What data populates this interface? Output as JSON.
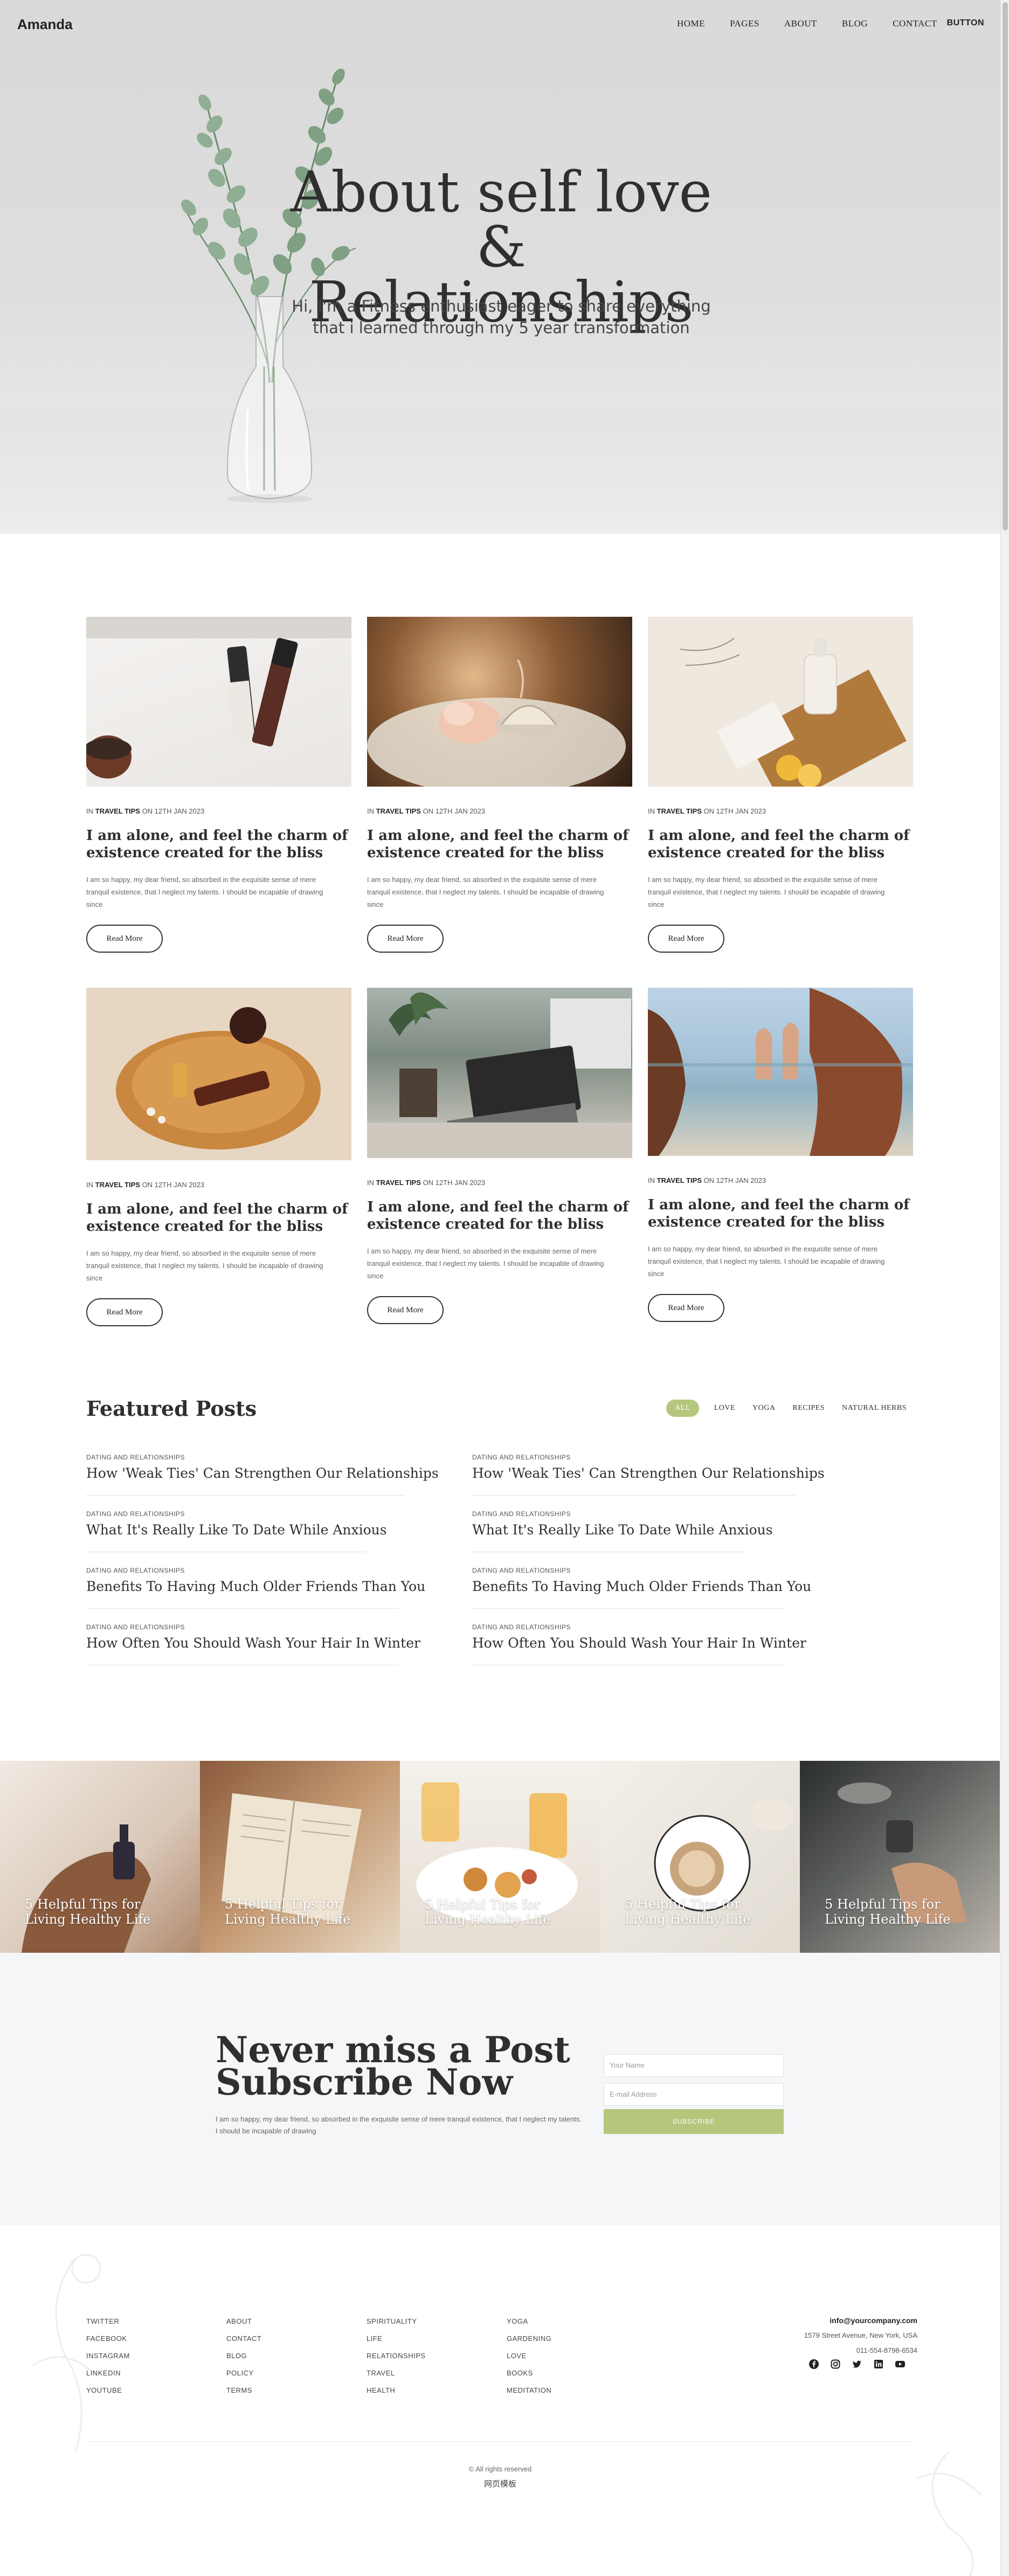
{
  "header": {
    "logo": "Amanda",
    "nav": [
      "HOME",
      "PAGES",
      "ABOUT",
      "BLOG",
      "CONTACT"
    ],
    "button": "BUTTON"
  },
  "hero": {
    "title_line1": "About self love &",
    "title_line2": "Relationships",
    "subtitle_line1": "Hi, I'm a Fitness enthusiast eager to share everything",
    "subtitle_line2": "that i learned through my 5 year transformation"
  },
  "posts": [
    {
      "in": "IN",
      "category": "TRAVEL TIPS",
      "date": "ON 12TH JAN 2023",
      "title": "I am alone, and feel the charm of existence created for the bliss",
      "excerpt": "I am so happy, my dear friend, so absorbed in the exquisite sense of mere tranquil existence, that I neglect my talents. I should be incapable of drawing since",
      "button": "Read More"
    },
    {
      "in": "IN",
      "category": "TRAVEL TIPS",
      "date": "ON 12TH JAN 2023",
      "title": "I am alone, and feel the charm of existence created for the bliss",
      "excerpt": "I am so happy, my dear friend, so absorbed in the exquisite sense of mere tranquil existence, that I neglect my talents. I should be incapable of drawing since",
      "button": "Read More"
    },
    {
      "in": "IN",
      "category": "TRAVEL TIPS",
      "date": "ON 12TH JAN 2023",
      "title": "I am alone, and feel the charm of existence created for the bliss",
      "excerpt": "I am so happy, my dear friend, so absorbed in the exquisite sense of mere tranquil existence, that I neglect my talents. I should be incapable of drawing since",
      "button": "Read More"
    },
    {
      "in": "IN",
      "category": "TRAVEL TIPS",
      "date": "ON 12TH JAN 2023",
      "title": "I am alone, and feel the charm of existence created for the bliss",
      "excerpt": "I am so happy, my dear friend, so absorbed in the exquisite sense of mere tranquil existence, that I neglect my talents. I should be incapable of drawing since",
      "button": "Read More"
    },
    {
      "in": "IN",
      "category": "TRAVEL TIPS",
      "date": "ON 12TH JAN 2023",
      "title": "I am alone, and feel the charm of existence created for the bliss",
      "excerpt": "I am so happy, my dear friend, so absorbed in the exquisite sense of mere tranquil existence, that I neglect my talents. I should be incapable of drawing since",
      "button": "Read More"
    },
    {
      "in": "IN",
      "category": "TRAVEL TIPS",
      "date": "ON 12TH JAN 2023",
      "title": "I am alone, and feel the charm of existence created for the bliss",
      "excerpt": "I am so happy, my dear friend, so absorbed in the exquisite sense of mere tranquil existence, that I neglect my talents. I should be incapable of drawing since",
      "button": "Read More"
    }
  ],
  "featured": {
    "title": "Featured Posts",
    "filters": [
      "ALL",
      "LOVE",
      "YOGA",
      "RECIPES",
      "NATURAL HERBS"
    ],
    "active_filter": "ALL",
    "items": [
      {
        "category": "DATING AND RELATIONSHIPS",
        "title": "How 'Weak Ties' Can Strengthen Our Relationships"
      },
      {
        "category": "DATING AND RELATIONSHIPS",
        "title": "How 'Weak Ties' Can Strengthen Our Relationships"
      },
      {
        "category": "DATING AND RELATIONSHIPS",
        "title": "What It's Really Like To Date While Anxious"
      },
      {
        "category": "DATING AND RELATIONSHIPS",
        "title": "What It's Really Like To Date While Anxious"
      },
      {
        "category": "DATING AND RELATIONSHIPS",
        "title": "Benefits To Having Much Older Friends Than You"
      },
      {
        "category": "DATING AND RELATIONSHIPS",
        "title": "Benefits To Having Much Older Friends Than You"
      },
      {
        "category": "DATING AND RELATIONSHIPS",
        "title": "How Often You Should Wash Your Hair In Winter"
      },
      {
        "category": "DATING AND RELATIONSHIPS",
        "title": "How Often You Should Wash Your Hair In Winter"
      }
    ]
  },
  "tips": [
    "5 Helpful Tips for Living Healthy Life",
    "5 Helpful Tips for Living Healthy Life",
    "5 Helpful Tips for Living Healthy Life",
    "5 Helpful Tips for Living Healthy Life",
    "5 Helpful Tips for Living Healthy Life"
  ],
  "subscribe": {
    "title_line1": "Never miss a Post",
    "title_line2": "Subscribe Now",
    "text": "I am so happy, my dear friend, so absorbed in the exquisite sense of mere tranquil existence, that I neglect my talents. I should be incapable of drawing",
    "name_placeholder": "Your Name",
    "email_placeholder": "E-mail Address",
    "button": "SUBSCRIBE"
  },
  "footer": {
    "col1": [
      "TWITTER",
      "FACEBOOK",
      "INSTAGRAM",
      "LINKEDIN",
      "YOUTUBE"
    ],
    "col2": [
      "ABOUT",
      "CONTACT",
      "BLOG",
      "POLICY",
      "TERMS"
    ],
    "col3": [
      "SPIRITUALITY",
      "LIFE",
      "RELATIONSHIPS",
      "TRAVEL",
      "HEALTH"
    ],
    "col4": [
      "YOGA",
      "GARDENING",
      "LOVE",
      "BOOKS",
      "MEDITATION"
    ],
    "email": "info@yourcompany.com",
    "address": "1579 Street Avenue, New York, USA",
    "phone": "011-554-8798-6534",
    "socials": [
      "facebook-icon",
      "instagram-icon",
      "twitter-icon",
      "linkedin-icon",
      "youtube-icon"
    ],
    "copyright": "© All rights reserved",
    "credit": "网页模板"
  }
}
